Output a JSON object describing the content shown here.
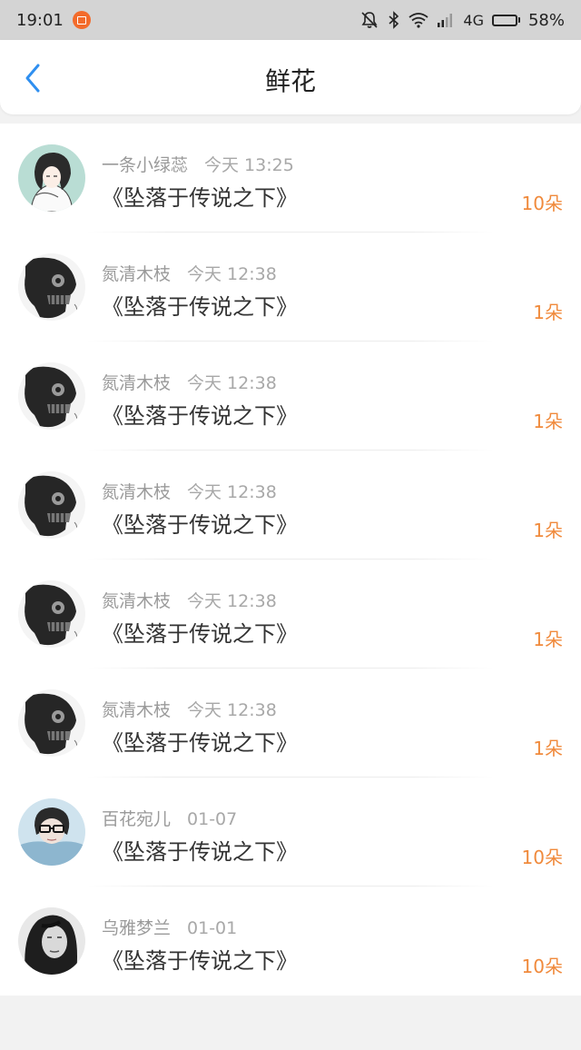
{
  "status_bar": {
    "time": "19:01",
    "network": "4G",
    "battery_percent": "58%",
    "battery_level": 0.58,
    "icons": [
      "orange-app-notification-icon",
      "mute-bell-icon",
      "bluetooth-icon",
      "wifi-icon",
      "signal-icon",
      "battery-icon"
    ]
  },
  "header": {
    "title": "鲜花",
    "back_icon": "chevron-left-icon"
  },
  "colors": {
    "accent_blue": "#2f8ff0",
    "count_orange": "#f08a3c",
    "status_bar_bg": "#d4d4d4"
  },
  "flowers": [
    {
      "user": "一条小绿蕊",
      "time": "今天 13:25",
      "book": "《坠落于传说之下》",
      "count": "10朵",
      "avatar": "anime-girl-avatar"
    },
    {
      "user": "氮清木枝",
      "time": "今天 12:38",
      "book": "《坠落于传说之下》",
      "count": "1朵",
      "avatar": "dark-skull-avatar"
    },
    {
      "user": "氮清木枝",
      "time": "今天 12:38",
      "book": "《坠落于传说之下》",
      "count": "1朵",
      "avatar": "dark-skull-avatar"
    },
    {
      "user": "氮清木枝",
      "time": "今天 12:38",
      "book": "《坠落于传说之下》",
      "count": "1朵",
      "avatar": "dark-skull-avatar"
    },
    {
      "user": "氮清木枝",
      "time": "今天 12:38",
      "book": "《坠落于传说之下》",
      "count": "1朵",
      "avatar": "dark-skull-avatar"
    },
    {
      "user": "氮清木枝",
      "time": "今天 12:38",
      "book": "《坠落于传说之下》",
      "count": "1朵",
      "avatar": "dark-skull-avatar"
    },
    {
      "user": "百花宛儿",
      "time": "01-07",
      "book": "《坠落于传说之下》",
      "count": "10朵",
      "avatar": "person-glasses-avatar"
    },
    {
      "user": "乌雅梦兰",
      "time": "01-01",
      "book": "《坠落于传说之下》",
      "count": "10朵",
      "avatar": "bw-woman-avatar"
    }
  ]
}
